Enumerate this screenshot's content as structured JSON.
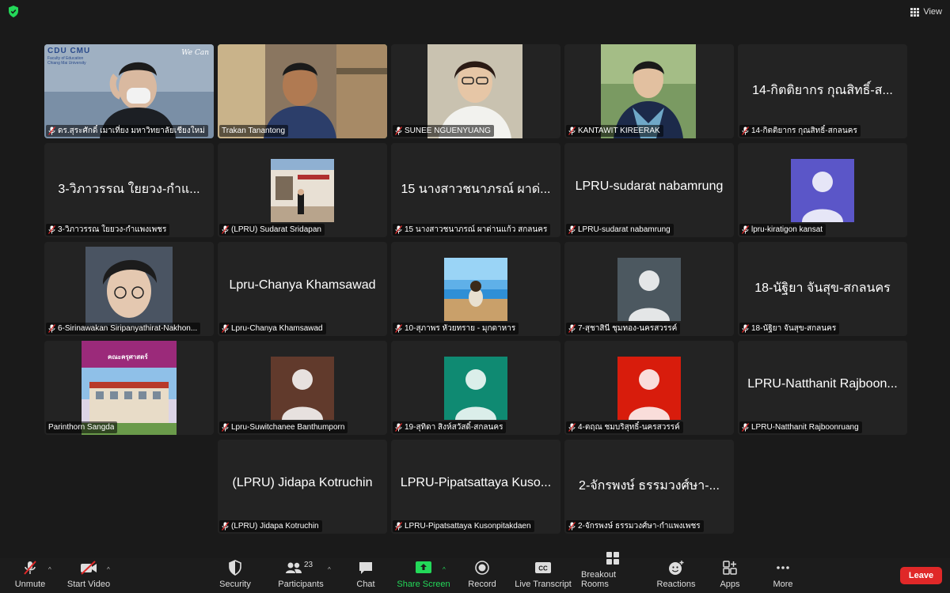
{
  "top": {
    "view_label": "View"
  },
  "tiles": [
    {
      "name": "ดร.สุระศักดิ์ เมาเที่ยง มหาวิทยาลัยเชียงใหม่",
      "big": "",
      "avatar_color": "",
      "muted": true
    },
    {
      "name": "Trakan Tanantong",
      "big": "",
      "avatar_color": "",
      "muted": false
    },
    {
      "name": "SUNEE NGUENYUANG",
      "big": "",
      "avatar_color": "",
      "muted": true
    },
    {
      "name": "KANTAWIT KIREERAK",
      "big": "",
      "avatar_color": "",
      "muted": true
    },
    {
      "name": "14-กิตติยากร กุณสิทธิ์-สกลนคร",
      "big": "14-กิตติยากร กุณสิทธิ์-ส...",
      "avatar_color": "",
      "muted": true
    },
    {
      "name": "3-วิภาวรรณ ใยยวง-กำแพงเพชร",
      "big": "3-วิภาวรรณ ใยยวง-กำแ...",
      "avatar_color": "",
      "muted": true
    },
    {
      "name": "(LPRU) Sudarat Sridapan",
      "big": "",
      "avatar_color": "",
      "muted": true
    },
    {
      "name": "15 นางสาวชนาภรณ์ ผาด่านแก้ว สกลนคร",
      "big": "15 นางสาวชนาภรณ์ ผาด่...",
      "avatar_color": "",
      "muted": true
    },
    {
      "name": "LPRU-sudarat nabamrung",
      "big": "LPRU-sudarat nabamrung",
      "avatar_color": "",
      "muted": true
    },
    {
      "name": "lpru-kiratigon kansat",
      "big": "",
      "avatar_color": "#5b56c8",
      "muted": true
    },
    {
      "name": "6-Sirinawakan Siripanyathirat-Nakhon...",
      "big": "",
      "avatar_color": "",
      "muted": true
    },
    {
      "name": "Lpru-Chanya Khamsawad",
      "big": "Lpru-Chanya Khamsawad",
      "avatar_color": "",
      "muted": true
    },
    {
      "name": "10-สุภาพร หัวยทราย - มุกดาหาร",
      "big": "",
      "avatar_color": "",
      "muted": true
    },
    {
      "name": "7-สุชาสินี ชุมทอง-นครสวรรค์",
      "big": "",
      "avatar_color": "#4c5860",
      "muted": true
    },
    {
      "name": "18-นัฐิยา จันสุข-สกลนคร",
      "big": "18-นัฐิยา จันสุข-สกลนคร",
      "avatar_color": "",
      "muted": true
    },
    {
      "name": "Parinthorn Sangda",
      "big": "",
      "avatar_color": "",
      "muted": false
    },
    {
      "name": "Lpru-Suwitchanee Banthumporn",
      "big": "",
      "avatar_color": "#613a2c",
      "muted": true
    },
    {
      "name": "19-สุทิดา สิงห์สวัสดิ์-สกลนคร",
      "big": "",
      "avatar_color": "#0f8a72",
      "muted": true
    },
    {
      "name": "4-ตฤณ ชมบริสุทธิ์-นครสวรรค์",
      "big": "",
      "avatar_color": "#d81c0c",
      "muted": true
    },
    {
      "name": "LPRU-Natthanit Rajboonruang",
      "big": "LPRU-Natthanit Rajboon...",
      "avatar_color": "",
      "muted": true
    },
    {
      "name": "(LPRU) Jidapa Kotruchin",
      "big": "(LPRU) Jidapa Kotruchin",
      "avatar_color": "",
      "muted": true
    },
    {
      "name": "LPRU-Pipatsattaya Kusonpitakdaen",
      "big": "LPRU-Pipatsattaya Kuso...",
      "avatar_color": "",
      "muted": true
    },
    {
      "name": "2-จักรพงษ์ ธรรมวงศ์ษา-กำแพงเพชร",
      "big": "2-จักรพงษ์ ธรรมวงศ์ษา-...",
      "avatar_color": "",
      "muted": true
    }
  ],
  "overlay_text": {
    "cmu_logo": "CDU CMU",
    "cmu_sub": "Faculty of Education Chiang Mai University",
    "wecan": "We Can",
    "school_banner": "คณะครุศาสตร์"
  },
  "toolbar": {
    "unmute": "Unmute",
    "start_video": "Start Video",
    "security": "Security",
    "participants": "Participants",
    "participants_count": "23",
    "chat": "Chat",
    "share_screen": "Share Screen",
    "record": "Record",
    "live_transcript": "Live Transcript",
    "breakout_rooms": "Breakout Rooms",
    "reactions": "Reactions",
    "apps": "Apps",
    "more": "More",
    "leave": "Leave"
  },
  "colors": {
    "share_green": "#23d959",
    "leave_red": "#e02828",
    "active_speaker": "#23d959"
  }
}
